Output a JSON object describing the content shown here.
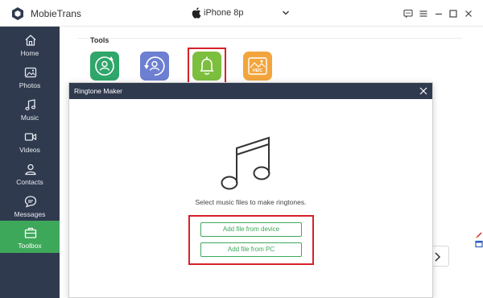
{
  "app": {
    "name": "MobieTrans",
    "device": "iPhone 8p"
  },
  "sidebar": {
    "items": [
      {
        "label": "Home",
        "icon": "home-icon"
      },
      {
        "label": "Photos",
        "icon": "photos-icon"
      },
      {
        "label": "Music",
        "icon": "music-icon"
      },
      {
        "label": "Videos",
        "icon": "videos-icon"
      },
      {
        "label": "Contacts",
        "icon": "contacts-icon"
      },
      {
        "label": "Messages",
        "icon": "messages-icon"
      },
      {
        "label": "Toolbox",
        "icon": "toolbox-icon",
        "active": true
      }
    ]
  },
  "tools": {
    "title": "Tools",
    "tiles": [
      {
        "icon": "backup-icon",
        "color": "#2fa66a"
      },
      {
        "icon": "restore-contacts-icon",
        "color": "#6d7fd1"
      },
      {
        "icon": "ringtone-bell-icon",
        "color": "#7cbf3e",
        "highlighted": true
      },
      {
        "icon": "heic-converter-icon",
        "color": "#f3a53d",
        "badge": "HEIC"
      }
    ]
  },
  "dialog": {
    "title": "Ringtone Maker",
    "message": "Select music files to make ringtones.",
    "buttons": {
      "from_device": "Add file from device",
      "from_pc": "Add file from PC"
    }
  },
  "colors": {
    "sidebar_bg": "#2f3a4e",
    "accent": "#3ea85a",
    "highlight": "#d6222a"
  }
}
